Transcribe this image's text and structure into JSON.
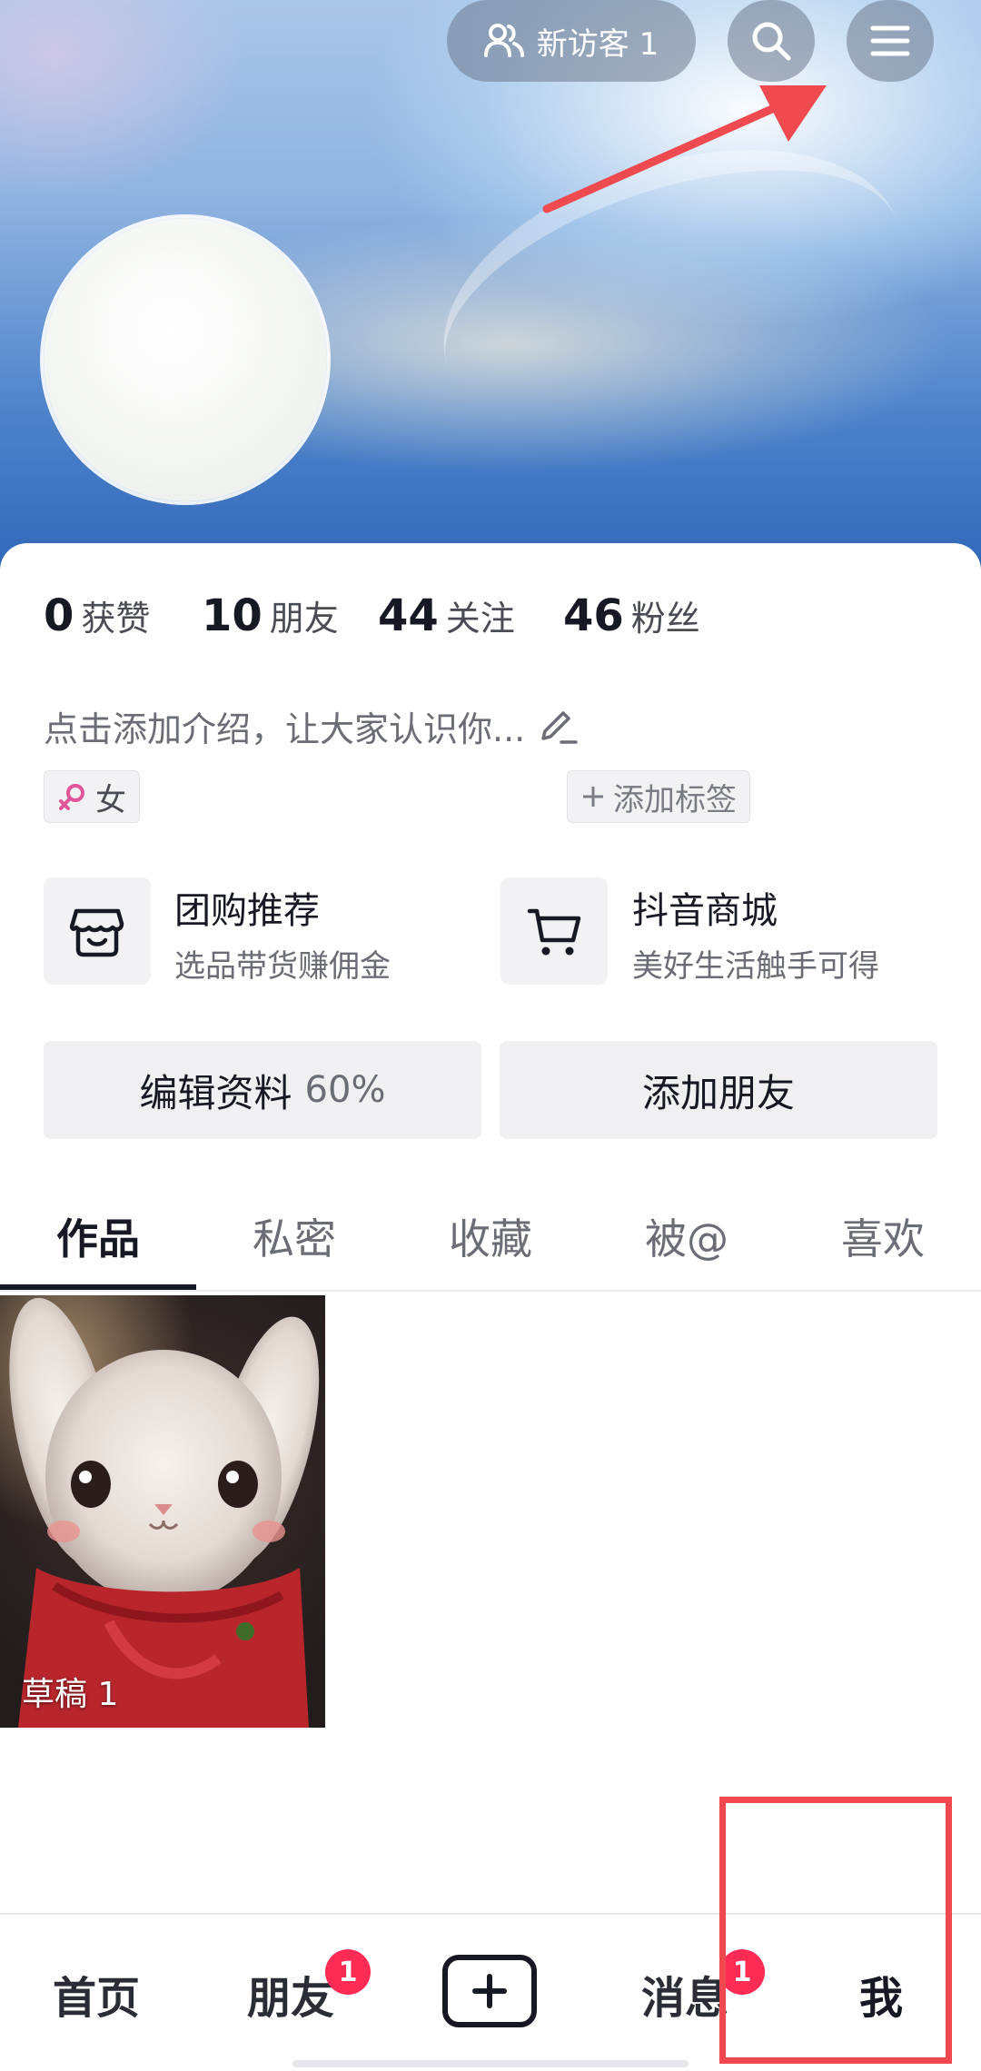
{
  "header": {
    "visitor_button": "新访客 1",
    "icons": [
      "visitors-icon",
      "search-icon",
      "menu-icon"
    ]
  },
  "stats": [
    {
      "value": "0",
      "label": "获赞"
    },
    {
      "value": "10",
      "label": "朋友"
    },
    {
      "value": "44",
      "label": "关注"
    },
    {
      "value": "46",
      "label": "粉丝"
    }
  ],
  "profile": {
    "bio_placeholder": "点击添加介绍，让大家认识你...",
    "gender_tag": "女",
    "add_tag": "添加标签"
  },
  "services": [
    {
      "title": "团购推荐",
      "subtitle": "选品带货赚佣金",
      "icon": "store-icon"
    },
    {
      "title": "抖音商城",
      "subtitle": "美好生活触手可得",
      "icon": "cart-icon"
    }
  ],
  "actions": {
    "edit_profile": "编辑资料",
    "edit_progress": "60%",
    "add_friend": "添加朋友"
  },
  "tabs": [
    {
      "label": "作品",
      "active": true
    },
    {
      "label": "私密",
      "active": false
    },
    {
      "label": "收藏",
      "active": false
    },
    {
      "label": "被@",
      "active": false
    },
    {
      "label": "喜欢",
      "active": false
    }
  ],
  "works": [
    {
      "label": "草稿 1"
    }
  ],
  "bottom_nav": {
    "home": "首页",
    "friends": "朋友",
    "friends_badge": "1",
    "messages": "消息",
    "messages_badge": "1",
    "me": "我"
  },
  "colors": {
    "badge": "#fe2c55",
    "annotation": "#f0484e",
    "gender_icon": "#e0569a"
  }
}
